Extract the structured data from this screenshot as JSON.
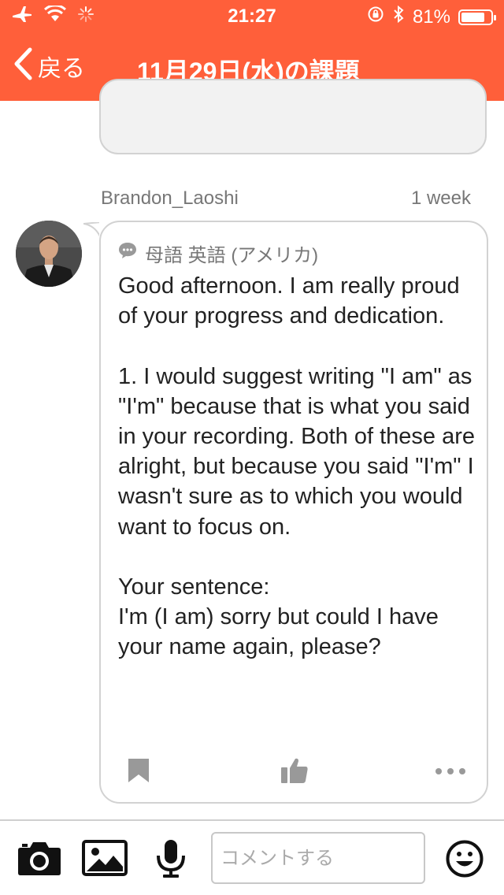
{
  "status_bar": {
    "time": "21:27",
    "battery_percent": "81%",
    "battery_level": 0.81,
    "icons": [
      "airplane-icon",
      "wifi-icon",
      "activity-spinner-icon",
      "orientation-lock-icon",
      "bluetooth-icon",
      "battery-icon"
    ]
  },
  "nav": {
    "back_label": "戻る",
    "title": "11月29日(水)の課題"
  },
  "comment": {
    "author": "Brandon_Laoshi",
    "time_ago": "1 week",
    "native_language": "母語 英語 (アメリカ)",
    "message": "Good afternoon. I am really proud of your progress and dedication.\n\n1. I would suggest writing \"I am\" as \"I'm\" because that is what you said in your recording. Both of these are alright, but because you said \"I'm\" I wasn't sure as to which you would want to focus on.\n\nYour sentence:\nI'm (I am) sorry but could I have your name again, please?"
  },
  "composer": {
    "placeholder": "コメントする"
  },
  "colors": {
    "accent": "#ff5f3a",
    "icon_gray": "#999999",
    "border_gray": "#d2d2d2"
  }
}
